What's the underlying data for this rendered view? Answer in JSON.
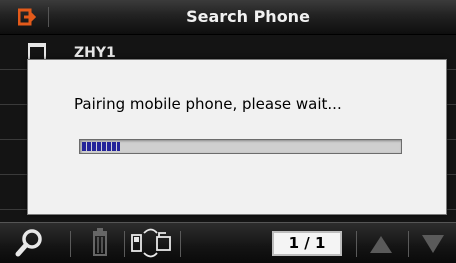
{
  "header": {
    "title": "Search Phone",
    "back_icon": "back-arrow-icon",
    "accent": "#e35a1a"
  },
  "list": {
    "items": [
      {
        "label": "ZHY1",
        "icon": "phone-device-icon"
      }
    ]
  },
  "dialog": {
    "message": "Pairing mobile phone, please wait...",
    "progress": 0.12,
    "progress_color": "#24249a"
  },
  "toolbar": {
    "search_icon": "search-icon",
    "delete_icon": "trash-icon",
    "sync_icon": "phone-sync-icon",
    "page": "1 / 1",
    "prev_icon": "up-arrow-icon",
    "next_icon": "down-arrow-icon"
  }
}
